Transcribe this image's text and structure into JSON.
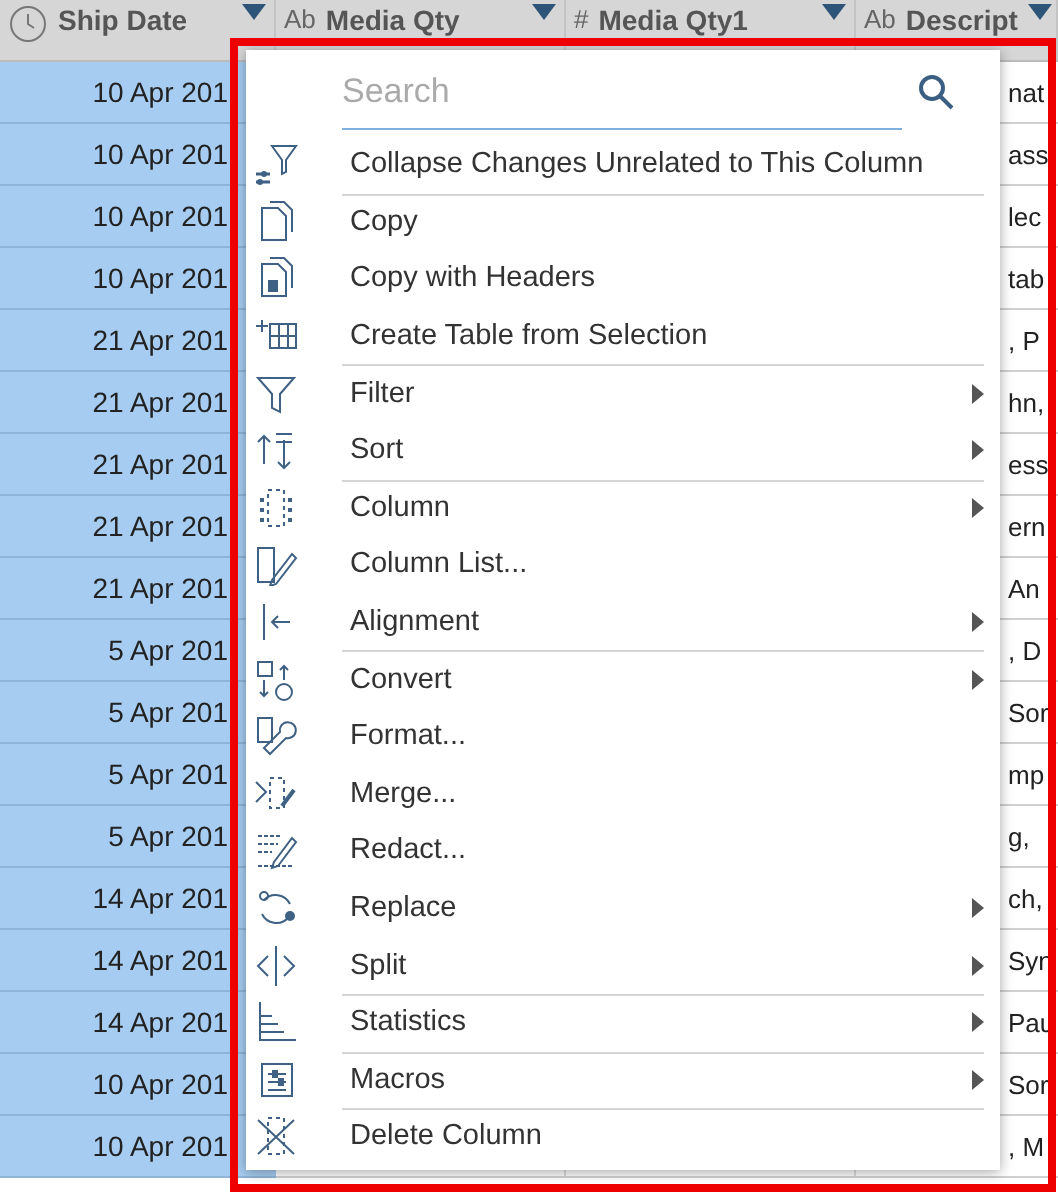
{
  "table": {
    "columns": [
      {
        "name": "Ship Date"
      },
      {
        "type_label": "Ab",
        "name": "Media Qty"
      },
      {
        "type_label": "#",
        "name": "Media Qty1"
      },
      {
        "type_label": "Ab",
        "name": "Descript"
      }
    ],
    "rows": [
      {
        "ship_date": "10 Apr 201",
        "column_4": "nat",
        "selected": true
      },
      {
        "ship_date": "10 Apr 201",
        "column_4": "ass",
        "selected": true
      },
      {
        "ship_date": "10 Apr 201",
        "column_4": "lec",
        "selected": true
      },
      {
        "ship_date": "10 Apr 201",
        "column_4": "tab",
        "selected": true
      },
      {
        "ship_date": "21 Apr 201",
        "column_4": ", P",
        "selected": true
      },
      {
        "ship_date": "21 Apr 201",
        "column_4": "hn,",
        "selected": true
      },
      {
        "ship_date": "21 Apr 201",
        "column_4": "ess",
        "selected": true
      },
      {
        "ship_date": "21 Apr 201",
        "column_4": "ern",
        "selected": true
      },
      {
        "ship_date": "21 Apr 201",
        "column_4": "An",
        "selected": true
      },
      {
        "ship_date": "5 Apr 201",
        "column_4": ", D",
        "selected": true
      },
      {
        "ship_date": "5 Apr 201",
        "column_4": "Sor",
        "selected": true
      },
      {
        "ship_date": "5 Apr 201",
        "column_4": "mp",
        "selected": true
      },
      {
        "ship_date": "5 Apr 201",
        "column_4": "g,",
        "selected": true
      },
      {
        "ship_date": "14 Apr 201",
        "column_4": "ch,",
        "selected": true
      },
      {
        "ship_date": "14 Apr 201",
        "column_4": "Syn",
        "selected": true
      },
      {
        "ship_date": "14 Apr 201",
        "column_4": "Pau",
        "selected": true
      },
      {
        "ship_date": "10 Apr 201",
        "column_4": "Sor",
        "selected": true
      },
      {
        "ship_date": "10 Apr 201",
        "column_4": ", M",
        "selected": true
      }
    ]
  },
  "context_menu": {
    "search": {
      "placeholder": "Search"
    },
    "items": [
      {
        "label": "Collapse Changes Unrelated to This Column",
        "submenu": false,
        "separator_before": false
      },
      {
        "label": "Copy",
        "submenu": false,
        "separator_before": true
      },
      {
        "label": "Copy with Headers",
        "submenu": false,
        "separator_before": false
      },
      {
        "label": "Create Table from Selection",
        "submenu": false,
        "separator_before": false
      },
      {
        "label": "Filter",
        "submenu": true,
        "separator_before": true
      },
      {
        "label": "Sort",
        "submenu": true,
        "separator_before": false
      },
      {
        "label": "Column",
        "submenu": true,
        "separator_before": true
      },
      {
        "label": "Column List...",
        "submenu": false,
        "separator_before": false
      },
      {
        "label": "Alignment",
        "submenu": true,
        "separator_before": false
      },
      {
        "label": "Convert",
        "submenu": true,
        "separator_before": true
      },
      {
        "label": "Format...",
        "submenu": false,
        "separator_before": false
      },
      {
        "label": "Merge...",
        "submenu": false,
        "separator_before": false
      },
      {
        "label": "Redact...",
        "submenu": false,
        "separator_before": false
      },
      {
        "label": "Replace",
        "submenu": true,
        "separator_before": false
      },
      {
        "label": "Split",
        "submenu": true,
        "separator_before": false
      },
      {
        "label": "Statistics",
        "submenu": true,
        "separator_before": true
      },
      {
        "label": "Macros",
        "submenu": true,
        "separator_before": true
      },
      {
        "label": "Delete Column",
        "submenu": false,
        "separator_before": true
      }
    ]
  }
}
